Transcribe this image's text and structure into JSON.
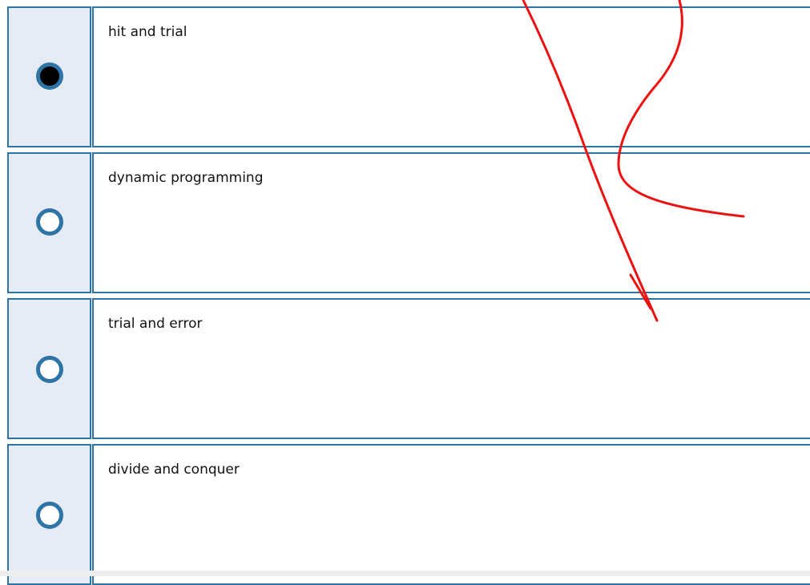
{
  "options": [
    {
      "label": "hit and trial",
      "selected": true
    },
    {
      "label": "dynamic programming",
      "selected": false
    },
    {
      "label": "trial and error",
      "selected": false
    },
    {
      "label": "divide and conquer",
      "selected": false
    }
  ],
  "colors": {
    "border": "#2e74a6",
    "radio_cell_background": "#e6ecf6",
    "annotation_ink": "#ee1111"
  }
}
